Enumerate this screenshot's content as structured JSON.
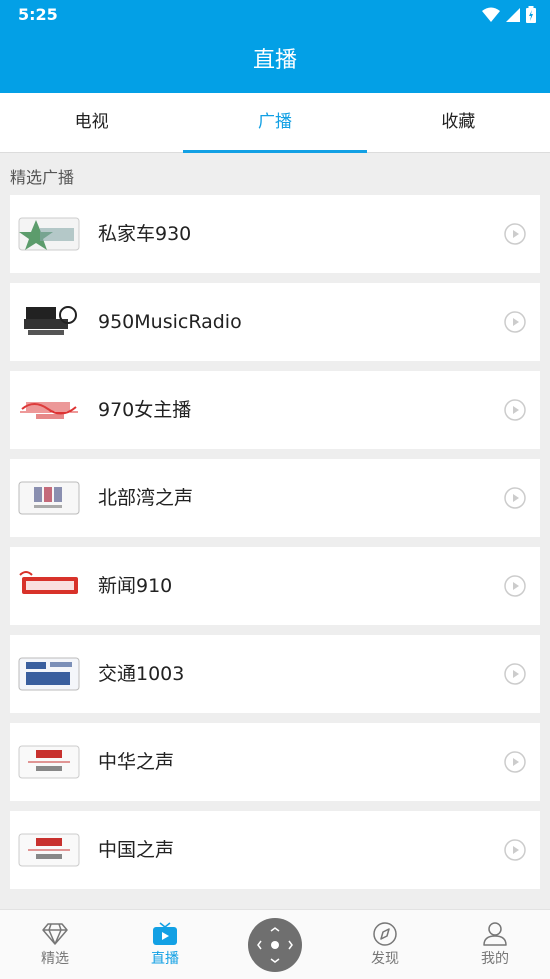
{
  "status_bar": {
    "time": "5:25"
  },
  "header": {
    "title": "直播"
  },
  "tabs": [
    {
      "label": "电视"
    },
    {
      "label": "广播"
    },
    {
      "label": "收藏"
    }
  ],
  "section": {
    "title": "精选广播"
  },
  "stations": [
    {
      "name": "私家车930"
    },
    {
      "name": "950MusicRadio"
    },
    {
      "name": "970女主播"
    },
    {
      "name": "北部湾之声"
    },
    {
      "name": "新闻910"
    },
    {
      "name": "交通1003"
    },
    {
      "name": "中华之声"
    },
    {
      "name": "中国之声"
    }
  ],
  "bottom_nav": [
    {
      "label": "精选"
    },
    {
      "label": "直播"
    },
    {
      "label": ""
    },
    {
      "label": "发现"
    },
    {
      "label": "我的"
    }
  ],
  "colors": {
    "primary": "#03a0e6",
    "accent": "#12a0e4"
  }
}
